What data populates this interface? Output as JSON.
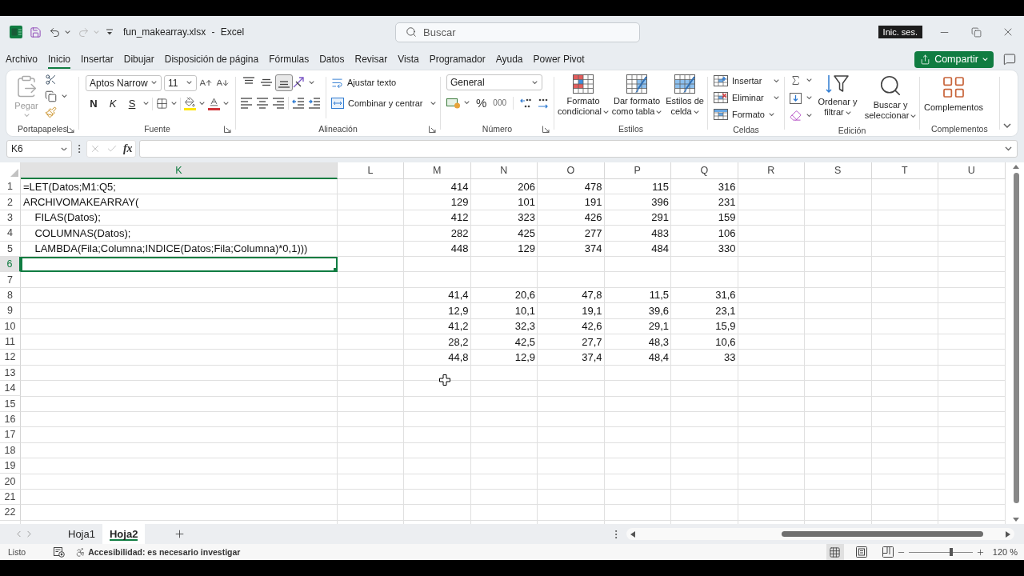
{
  "window": {
    "title": "fun_makearray.xlsx - Excel",
    "search": {
      "placeholder": "Buscar"
    },
    "account": "Inic. ses."
  },
  "quick_access": [
    {
      "kind": "save",
      "disabled": false
    },
    {
      "kind": "undo",
      "disabled": false
    },
    {
      "kind": "redo",
      "disabled": true
    }
  ],
  "menu": {
    "tabs": [
      {
        "label": "Archivo",
        "selected": false
      },
      {
        "label": "Inicio",
        "selected": true
      },
      {
        "label": "Insertar",
        "selected": false
      },
      {
        "label": "Dibujar",
        "selected": false
      },
      {
        "label": "Disposición de página",
        "selected": false
      },
      {
        "label": "Fórmulas",
        "selected": false
      },
      {
        "label": "Datos",
        "selected": false
      },
      {
        "label": "Revisar",
        "selected": false
      },
      {
        "label": "Vista",
        "selected": false
      },
      {
        "label": "Programador",
        "selected": false
      },
      {
        "label": "Ayuda",
        "selected": false
      },
      {
        "label": "Power Pivot",
        "selected": false
      }
    ],
    "share": "Compartir"
  },
  "ribbon": {
    "clipboard": {
      "label": "Portapapeles",
      "paste": {
        "label": "Pegar",
        "disabled": true
      }
    },
    "font": {
      "label": "Fuente",
      "font_name": "Aptos Narrow",
      "font_size": "11",
      "styles": [
        {
          "kind": "bold",
          "label": "N"
        },
        {
          "kind": "italic",
          "label": "K"
        },
        {
          "kind": "underline",
          "label": "S"
        }
      ]
    },
    "alignment": {
      "label": "Alineación",
      "vertical": [
        {
          "kind": "top",
          "selected": false
        },
        {
          "kind": "middle",
          "selected": false
        },
        {
          "kind": "bottom",
          "selected": true
        }
      ],
      "wrap_text": "Ajustar texto",
      "merge": "Combinar y centrar"
    },
    "number": {
      "label": "Número",
      "format": "General",
      "percent": "%",
      "thousands": "000"
    },
    "styles": {
      "label": "Estilos",
      "buttons": [
        {
          "kind": "conditional",
          "label": "Formato condicional"
        },
        {
          "kind": "table",
          "label": "Dar formato como tabla"
        },
        {
          "kind": "cell_styles",
          "label": "Estilos de celda"
        }
      ]
    },
    "cells": {
      "label": "Celdas",
      "buttons": [
        {
          "kind": "insert",
          "label": "Insertar"
        },
        {
          "kind": "delete",
          "label": "Eliminar"
        },
        {
          "kind": "format",
          "label": "Formato"
        }
      ]
    },
    "editing": {
      "label": "Edición",
      "buttons": [
        {
          "kind": "sort",
          "label": "Ordenar y filtrar"
        },
        {
          "kind": "find",
          "label": "Buscar y seleccionar"
        }
      ]
    },
    "addins": {
      "label": "Complementos",
      "button": "Complementos"
    }
  },
  "formula_bar": {
    "name_box": "K6",
    "function_label": "fx"
  },
  "sheet": {
    "columns": [
      {
        "label": "K",
        "selected": true
      },
      {
        "label": "L",
        "selected": false
      },
      {
        "label": "M",
        "selected": false
      },
      {
        "label": "N",
        "selected": false
      },
      {
        "label": "O",
        "selected": false
      },
      {
        "label": "P",
        "selected": false
      },
      {
        "label": "Q",
        "selected": false
      },
      {
        "label": "R",
        "selected": false
      },
      {
        "label": "S",
        "selected": false
      },
      {
        "label": "T",
        "selected": false
      },
      {
        "label": "U",
        "selected": false
      }
    ],
    "rows": [
      {
        "label": "1",
        "selected": false,
        "text": "=LET(Datos;M1:Q5;",
        "values": [
          "414",
          "206",
          "478",
          "115",
          "316"
        ]
      },
      {
        "label": "2",
        "selected": false,
        "text": "ARCHIVOMAKEARRAY(",
        "values": [
          "129",
          "101",
          "191",
          "396",
          "231"
        ]
      },
      {
        "label": "3",
        "selected": false,
        "text": "    FILAS(Datos);",
        "values": [
          "412",
          "323",
          "426",
          "291",
          "159"
        ]
      },
      {
        "label": "4",
        "selected": false,
        "text": "    COLUMNAS(Datos);",
        "values": [
          "282",
          "425",
          "277",
          "483",
          "106"
        ]
      },
      {
        "label": "5",
        "selected": false,
        "text": "    LAMBDA(Fila;Columna;INDICE(Datos;Fila;Columna)*0,1)))",
        "values": [
          "448",
          "129",
          "374",
          "484",
          "330"
        ]
      },
      {
        "label": "6",
        "selected": true
      },
      {
        "label": "7",
        "selected": false
      },
      {
        "label": "8",
        "selected": false,
        "values": [
          "41,4",
          "20,6",
          "47,8",
          "11,5",
          "31,6"
        ]
      },
      {
        "label": "9",
        "selected": false,
        "values": [
          "12,9",
          "10,1",
          "19,1",
          "39,6",
          "23,1"
        ]
      },
      {
        "label": "10",
        "selected": false,
        "values": [
          "41,2",
          "32,3",
          "42,6",
          "29,1",
          "15,9"
        ]
      },
      {
        "label": "11",
        "selected": false,
        "values": [
          "28,2",
          "42,5",
          "27,7",
          "48,3",
          "10,6"
        ]
      },
      {
        "label": "12",
        "selected": false,
        "values": [
          "44,8",
          "12,9",
          "37,4",
          "48,4",
          "33"
        ]
      },
      {
        "label": "13",
        "selected": false
      },
      {
        "label": "14",
        "selected": false
      },
      {
        "label": "15",
        "selected": false
      },
      {
        "label": "16",
        "selected": false
      },
      {
        "label": "17",
        "selected": false
      },
      {
        "label": "18",
        "selected": false
      },
      {
        "label": "19",
        "selected": false
      },
      {
        "label": "20",
        "selected": false
      },
      {
        "label": "21",
        "selected": false
      },
      {
        "label": "22",
        "selected": false
      }
    ]
  },
  "sheet_tabs": [
    {
      "label": "Hoja1",
      "selected": false
    },
    {
      "label": "Hoja2",
      "selected": true
    }
  ],
  "status_bar": {
    "ready": "Listo",
    "accessibility": "Accesibilidad: es necesario investigar",
    "views": [
      {
        "kind": "normal",
        "selected": true
      },
      {
        "kind": "page_layout",
        "selected": false
      },
      {
        "kind": "page_break",
        "selected": false
      }
    ],
    "zoom": {
      "level": 0.67,
      "label": "120 %"
    }
  }
}
